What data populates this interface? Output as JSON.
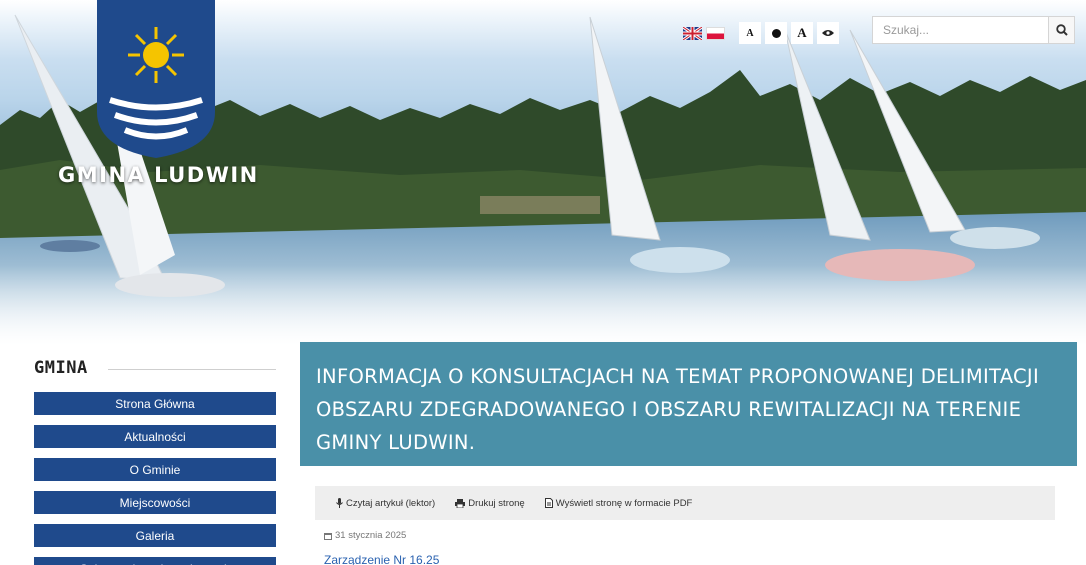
{
  "header": {
    "brand": "GMINA LUDWIN",
    "tools": {
      "lang_en_icon": "uk-flag-icon",
      "lang_pl_icon": "pl-flag-icon",
      "font_small_label": "A",
      "contrast_icon": "contrast-icon",
      "font_large_label": "A",
      "visibility_icon": "eye-icon"
    },
    "search": {
      "placeholder": "Szukaj...",
      "icon": "search-icon"
    }
  },
  "sidebar": {
    "title": "GMINA",
    "items": [
      {
        "label": "Strona Główna"
      },
      {
        "label": "Aktualności"
      },
      {
        "label": "O Gminie"
      },
      {
        "label": "Miejscowości"
      },
      {
        "label": "Galeria"
      },
      {
        "label": "Ochrona danych osobowych"
      }
    ]
  },
  "article": {
    "title": "INFORMACJA O KONSULTACJACH NA TEMAT PROPONOWANEJ DELIMITACJI OBSZARU ZDEGRADOWANEGO I OBSZARU REWITALIZACJI NA TERENIE GMINY LUDWIN.",
    "toolbar": {
      "read": "Czytaj artykuł (lektor)",
      "print": "Drukuj stronę",
      "pdf": "Wyświetl stronę w formacie PDF"
    },
    "date": "31 stycznia 2025",
    "link": "Zarządzenie Nr 16.25"
  },
  "colors": {
    "menu_bg": "#1f4a8c",
    "banner_bg": "#4a90a8",
    "link": "#2a62b0"
  }
}
